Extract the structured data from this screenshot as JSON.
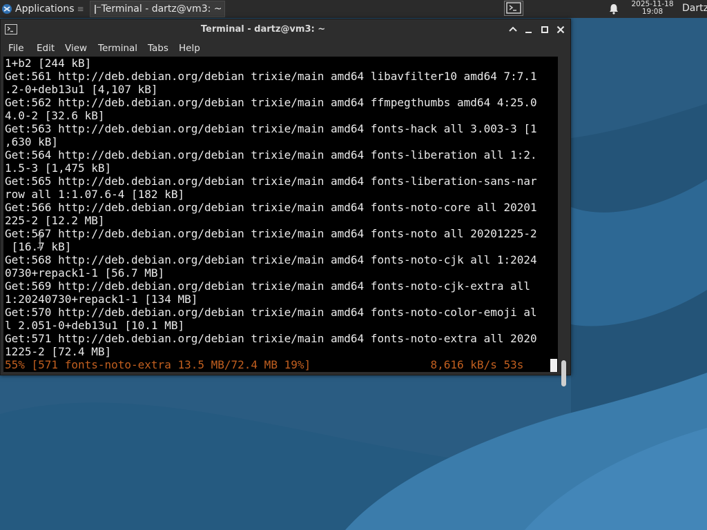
{
  "panel": {
    "applications_label": "Applications",
    "task_label": "Terminal - dartz@vm3: ~",
    "clock_date": "2025-11-18",
    "clock_time": "19:08",
    "user_label": "Dartz"
  },
  "window": {
    "title": "Terminal - dartz@vm3: ~",
    "menus": [
      "File",
      "Edit",
      "View",
      "Terminal",
      "Tabs",
      "Help"
    ]
  },
  "terminal": {
    "lines": [
      "1+b2 [244 kB]",
      "Get:561 http://deb.debian.org/debian trixie/main amd64 libavfilter10 amd64 7:7.1",
      ".2-0+deb13u1 [4,107 kB]",
      "Get:562 http://deb.debian.org/debian trixie/main amd64 ffmpegthumbs amd64 4:25.0",
      "4.0-2 [32.6 kB]",
      "Get:563 http://deb.debian.org/debian trixie/main amd64 fonts-hack all 3.003-3 [1",
      ",630 kB]",
      "Get:564 http://deb.debian.org/debian trixie/main amd64 fonts-liberation all 1:2.",
      "1.5-3 [1,475 kB]",
      "Get:565 http://deb.debian.org/debian trixie/main amd64 fonts-liberation-sans-nar",
      "row all 1:1.07.6-4 [182 kB]",
      "Get:566 http://deb.debian.org/debian trixie/main amd64 fonts-noto-core all 20201",
      "225-2 [12.2 MB]",
      "Get:567 http://deb.debian.org/debian trixie/main amd64 fonts-noto all 20201225-2",
      " [16.7 kB]",
      "Get:568 http://deb.debian.org/debian trixie/main amd64 fonts-noto-cjk all 1:2024",
      "0730+repack1-1 [56.7 MB]",
      "Get:569 http://deb.debian.org/debian trixie/main amd64 fonts-noto-cjk-extra all ",
      "1:20240730+repack1-1 [134 MB]",
      "Get:570 http://deb.debian.org/debian trixie/main amd64 fonts-noto-color-emoji al",
      "l 2.051-0+deb13u1 [10.1 MB]",
      "Get:571 http://deb.debian.org/debian trixie/main amd64 fonts-noto-extra all 2020",
      "1225-2 [72.4 MB]"
    ],
    "progress_line": "55% [571 fonts-noto-extra 13.5 MB/72.4 MB 19%]                  8,616 kB/s 53s"
  },
  "colors": {
    "terminal_bg": "#000000",
    "terminal_fg": "#ebebeb",
    "progress_fg": "#c25f1f",
    "chrome_bg": "#2d2d2d",
    "desktop_bg": "#2b5f86"
  }
}
